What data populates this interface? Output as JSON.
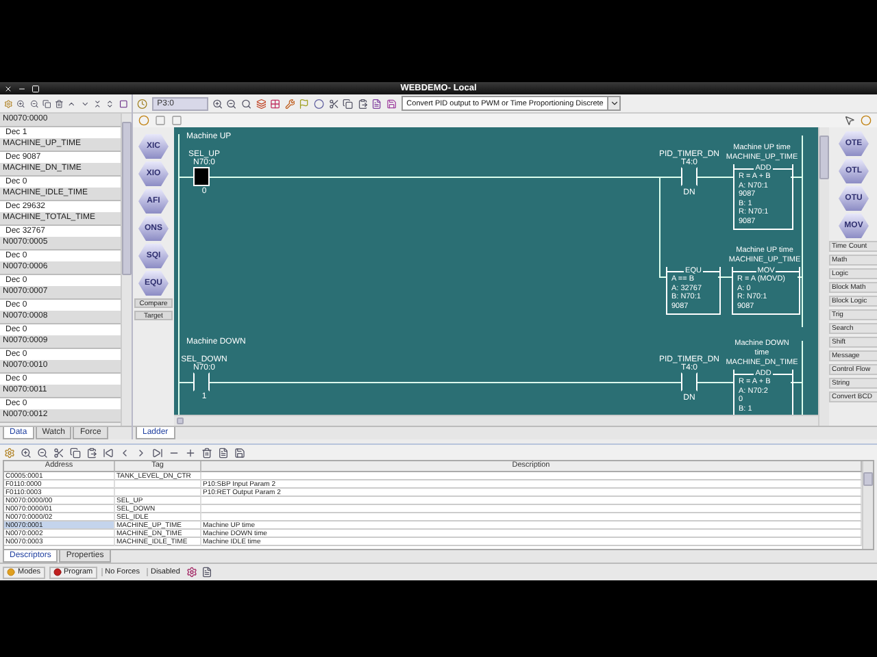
{
  "window": {
    "title": "WEBDEMO- Local"
  },
  "data_list": [
    {
      "address": "N0070:0000",
      "value": "Dec 1"
    },
    {
      "address": "MACHINE_UP_TIME",
      "value": "Dec 9087"
    },
    {
      "address": "MACHINE_DN_TIME",
      "value": "Dec 0"
    },
    {
      "address": "MACHINE_IDLE_TIME",
      "value": "Dec 29632"
    },
    {
      "address": "MACHINE_TOTAL_TIME",
      "value": "Dec 32767"
    },
    {
      "address": "N0070:0005",
      "value": "Dec 0"
    },
    {
      "address": "N0070:0006",
      "value": "Dec 0"
    },
    {
      "address": "N0070:0007",
      "value": "Dec 0"
    },
    {
      "address": "N0070:0008",
      "value": "Dec 0"
    },
    {
      "address": "N0070:0009",
      "value": "Dec 0"
    },
    {
      "address": "N0070:0010",
      "value": "Dec 0"
    },
    {
      "address": "N0070:0011",
      "value": "Dec 0"
    },
    {
      "address": "N0070:0012"
    }
  ],
  "left_tabs": [
    {
      "label": "Data",
      "selected": true
    },
    {
      "label": "Watch",
      "selected": false
    },
    {
      "label": "Force",
      "selected": false
    }
  ],
  "editor_toolbar": {
    "routine": "P3:0",
    "description": "Convert PID output to PWM or Time Proportioning Discrete"
  },
  "instruction_palette": [
    "XIC",
    "XIO",
    "AFI",
    "ONS",
    "SQI",
    "EQU"
  ],
  "palette_groups": [
    "Compare",
    "Target"
  ],
  "output_palette": [
    "OTE",
    "OTL",
    "OTU",
    "MOV"
  ],
  "categories": [
    "Time Count",
    "Math",
    "Logic",
    "Block Math",
    "Block Logic",
    "Trig",
    "Search",
    "Shift",
    "Message",
    "Control Flow",
    "String",
    "Convert BCD"
  ],
  "rungs": [
    {
      "comment": "Machine UP",
      "input": {
        "tag": "SEL_UP",
        "address": "N70:0",
        "value": "0",
        "energized": true
      },
      "timer": {
        "tag": "PID_TIMER_DN",
        "address": "T4:0",
        "bit": "DN"
      },
      "blocks": [
        {
          "kind": "add",
          "comment": "Machine UP time",
          "tag": "MACHINE_UP_TIME",
          "name": "ADD",
          "lines": [
            "R = A + B",
            "A: N70:1",
            "9087",
            "B: 1",
            "R: N70:1",
            "9087"
          ]
        },
        {
          "kind": "equ",
          "name": "EQU",
          "lines": [
            "A == B",
            "A: 32767",
            "B: N70:1",
            "9087"
          ]
        },
        {
          "kind": "mov",
          "comment": "Machine UP time",
          "tag": "MACHINE_UP_TIME",
          "name": "MOV",
          "lines": [
            "R = A (MOVD)",
            "A: 0",
            "R: N70:1",
            "9087"
          ]
        }
      ]
    },
    {
      "comment": "Machine DOWN",
      "input": {
        "tag": "SEL_DOWN",
        "address": "N70:0",
        "value": "1",
        "energized": false
      },
      "timer": {
        "tag": "PID_TIMER_DN",
        "address": "T4:0",
        "bit": "DN"
      },
      "blocks": [
        {
          "kind": "add",
          "comment": "Machine DOWN time",
          "tag": "MACHINE_DN_TIME",
          "name": "ADD",
          "lines": [
            "R = A + B",
            "A: N70:2",
            "0",
            "B: 1"
          ]
        }
      ]
    }
  ],
  "editor_tabs": [
    {
      "label": "Ladder",
      "selected": true
    }
  ],
  "table": {
    "columns": [
      "Address",
      "Tag",
      "Description"
    ],
    "rows": [
      {
        "address": "C0005:0001",
        "tag": "TANK_LEVEL_DN_CTR",
        "selected": false
      },
      {
        "address": "F0110:0000",
        "description": "P10:SBP Input Param 2",
        "selected": false
      },
      {
        "address": "F0110:0003",
        "description": "P10:RET Output Param 2",
        "selected": false
      },
      {
        "address": "N0070:0000/00",
        "tag": "SEL_UP",
        "selected": false
      },
      {
        "address": "N0070:0000/01",
        "tag": "SEL_DOWN",
        "selected": false
      },
      {
        "address": "N0070:0000/02",
        "tag": "SEL_IDLE",
        "selected": false
      },
      {
        "address": "N0070:0001",
        "tag": "MACHINE_UP_TIME",
        "description": "Machine UP time",
        "selected": true
      },
      {
        "address": "N0070:0002",
        "tag": "MACHINE_DN_TIME",
        "description": "Machine DOWN time",
        "selected": false
      },
      {
        "address": "N0070:0003",
        "tag": "MACHINE_IDLE_TIME",
        "description": "Machine IDLE time",
        "selected": false
      }
    ]
  },
  "bottom_tabs": [
    {
      "label": "Descriptors",
      "selected": true
    },
    {
      "label": "Properties",
      "selected": false
    }
  ],
  "status_bar": {
    "modes": "Modes",
    "program": "Program",
    "forces": "No Forces",
    "disabled": "Disabled"
  }
}
